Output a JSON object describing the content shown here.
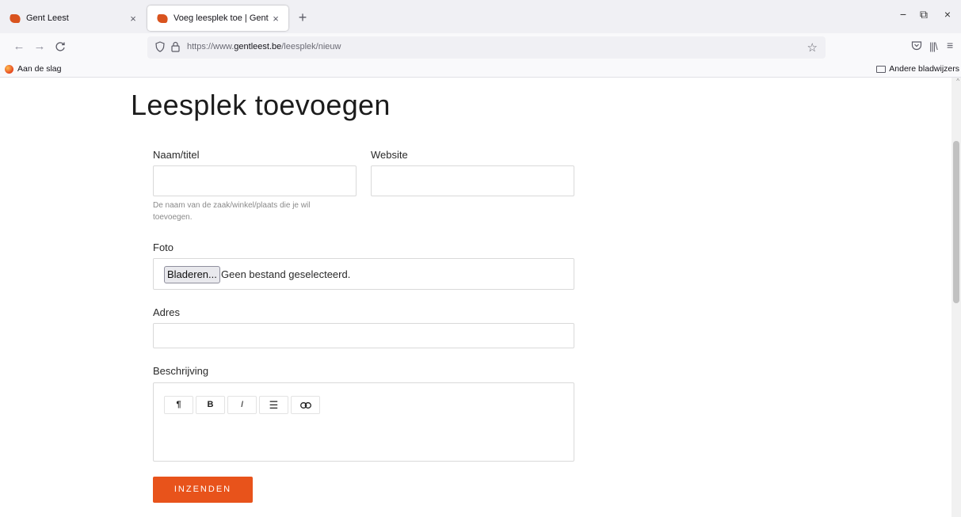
{
  "browser": {
    "tabs": [
      {
        "title": "Gent Leest",
        "close": "×"
      },
      {
        "title": "Voeg leesplek toe | Gent Leest",
        "close": "×"
      }
    ],
    "new_tab": "+",
    "window_controls": {
      "minimize": "−",
      "restore": "⧉",
      "close": "×"
    },
    "nav": {
      "back": "←",
      "forward": "→",
      "reload": "C"
    },
    "url": {
      "prefix": "https://www.",
      "domain": "gentleest.be",
      "path": "/leesplek/nieuw"
    },
    "bookmarks": {
      "left": "Aan de slag",
      "right": "Andere bladwijzers"
    },
    "icons": {
      "shield": "shield-icon",
      "lock": "lock-icon",
      "star": "star-icon",
      "pocket": "pocket-icon",
      "library": "library-icon",
      "menu": "hamburger-menu-icon"
    }
  },
  "page": {
    "title": "Leesplek toevoegen",
    "form": {
      "name_label": "Naam/titel",
      "name_value": "",
      "name_help": "De naam van de zaak/winkel/plaats die je wil toevoegen.",
      "website_label": "Website",
      "website_value": "",
      "photo_label": "Foto",
      "photo_button": "Bladeren...",
      "photo_status": "Geen bestand geselecteerd.",
      "address_label": "Adres",
      "address_value": "",
      "description_label": "Beschrijving",
      "toolbar": {
        "paragraph": "¶",
        "bold": "B",
        "italic": "I",
        "list": "☰",
        "link": "⊖"
      },
      "submit_label": "INZENDEN"
    }
  },
  "colors": {
    "brand": "#e8531b",
    "favicon": "#d9531e"
  }
}
